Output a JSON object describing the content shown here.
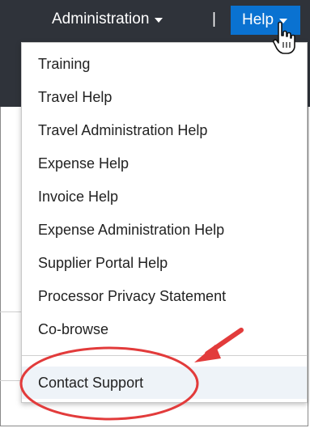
{
  "header": {
    "admin_label": "Administration",
    "separator": "|",
    "help_label": "Help"
  },
  "help_menu": {
    "items": [
      "Training",
      "Travel Help",
      "Travel Administration Help",
      "Expense Help",
      "Invoice Help",
      "Expense Administration Help",
      "Supplier Portal Help",
      "Processor Privacy Statement",
      "Co-browse"
    ],
    "contact_label": "Contact Support"
  },
  "colors": {
    "topbar": "#2f333a",
    "help_active": "#0a72d1",
    "annotation": "#e23b3b"
  },
  "icons": {
    "cursor": "hand-pointer-icon",
    "caret": "caret-down-icon",
    "annotation_arrow": "arrow-icon"
  }
}
